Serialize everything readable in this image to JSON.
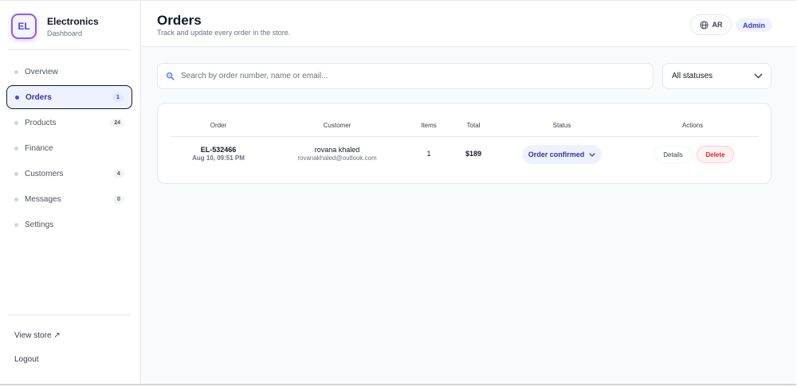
{
  "brand": {
    "logo_text": "EL",
    "name": "Electronics",
    "subtitle": "Dashboard",
    "accent": "#4f46e5"
  },
  "sidebar": {
    "items": [
      {
        "label": "Overview",
        "badge": ""
      },
      {
        "label": "Orders",
        "badge": "1",
        "active": true
      },
      {
        "label": "Products",
        "badge": "24"
      },
      {
        "label": "Finance",
        "badge": ""
      },
      {
        "label": "Customers",
        "badge": "4"
      },
      {
        "label": "Messages",
        "badge": "0"
      },
      {
        "label": "Settings",
        "badge": ""
      }
    ],
    "view_store": "View store ↗",
    "logout": "Logout"
  },
  "header": {
    "title": "Orders",
    "subtitle": "Track and update every order in the store.",
    "language": "AR",
    "role": "Admin"
  },
  "filters": {
    "search_placeholder": "Search by order number, name or email...",
    "status_selected": "All statuses"
  },
  "table": {
    "columns": {
      "order": "Order",
      "customer": "Customer",
      "items": "Items",
      "total": "Total",
      "status": "Status",
      "actions": "Actions"
    },
    "rows": [
      {
        "order_id": "EL-532466",
        "date": "Aug 10, 09:51 PM",
        "customer_name": "rovana khaled",
        "customer_email": "rovanakhaled@outlook.com",
        "items": "1",
        "total": "$189",
        "status": "Order confirmed",
        "details_label": "Details",
        "delete_label": "Delete"
      }
    ]
  },
  "colors": {
    "active_nav_bg": "#eef2ff",
    "status_pill_bg": "#eef2ff",
    "delete_text": "#dc2626"
  }
}
